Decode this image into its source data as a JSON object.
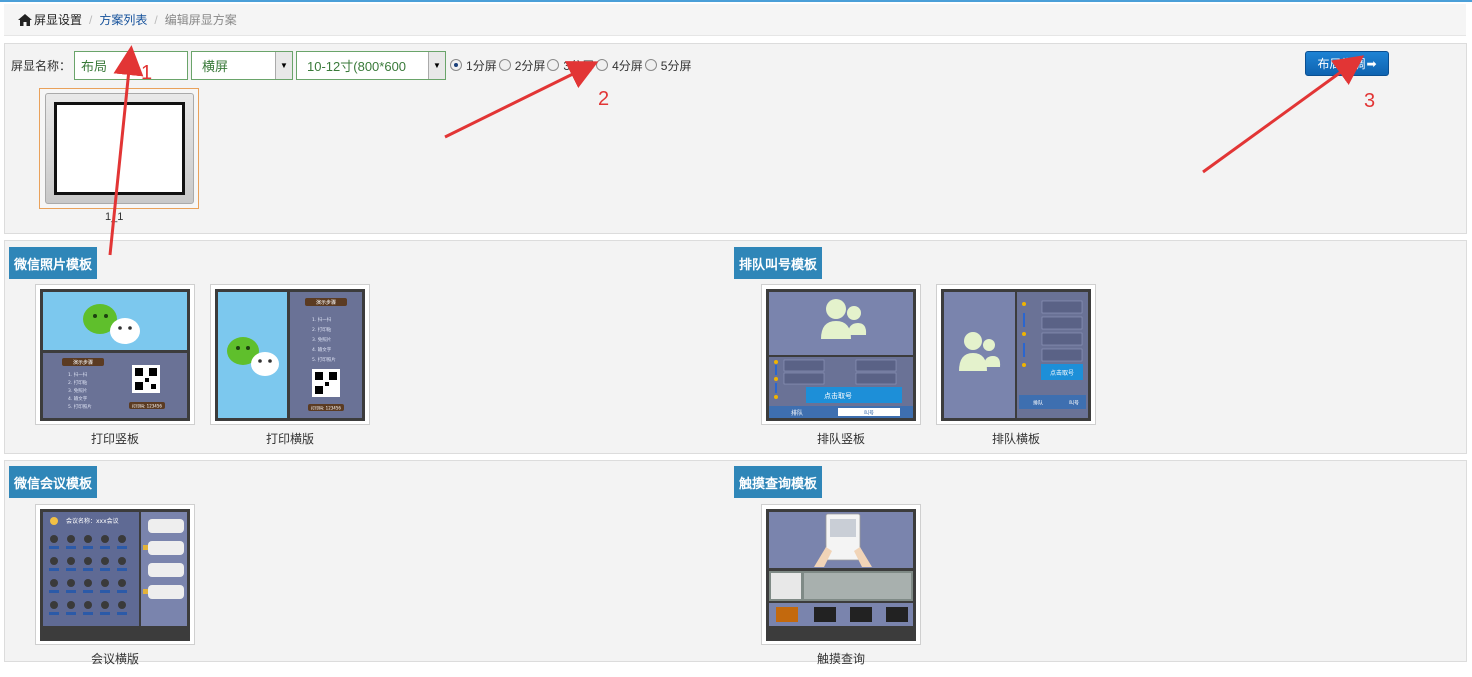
{
  "breadcrumb": {
    "home_label": "屏显设置",
    "list_label": "方案列表",
    "current_label": "编辑屏显方案",
    "separator": "/"
  },
  "form": {
    "name_label": "屏显名称：",
    "name_value": "布局",
    "orientation_value": "横屏",
    "size_value": "10-12寸(800*600",
    "split_options": [
      "1分屏",
      "2分屏",
      "3分屏",
      "4分屏",
      "5分屏"
    ],
    "split_selected_index": 0,
    "fine_tune_label": "布局微调",
    "fine_tune_arrow": "➡"
  },
  "layout_thumb_label": "1_1",
  "sections": {
    "wechat_photo": {
      "title": "微信照片模板",
      "items": [
        "打印竖板",
        "打印横版"
      ]
    },
    "queue": {
      "title": "排队叫号模板",
      "items": [
        "排队竖板",
        "排队横板"
      ]
    },
    "wechat_meeting": {
      "title": "微信会议模板",
      "items": [
        "会议横版"
      ]
    },
    "touch_query": {
      "title": "触摸查询模板",
      "items": [
        "触摸查询"
      ]
    }
  },
  "thumb_text": {
    "steps_title": "演示步骤",
    "steps": [
      "扫一扫",
      "打印贴",
      "免照片",
      "输文字",
      "打印照片"
    ],
    "print_code": "打印码: 123456",
    "take_number": "点击取号",
    "queue_label": "排队",
    "call_label": "叫号",
    "meeting_title": "会议名称：xxx会议"
  },
  "annotations": [
    "1",
    "2",
    "3"
  ],
  "colors": {
    "accent": "#2f86b8",
    "button": "#1173c5",
    "annotation": "#e23535",
    "input_border": "#6aa46a"
  }
}
